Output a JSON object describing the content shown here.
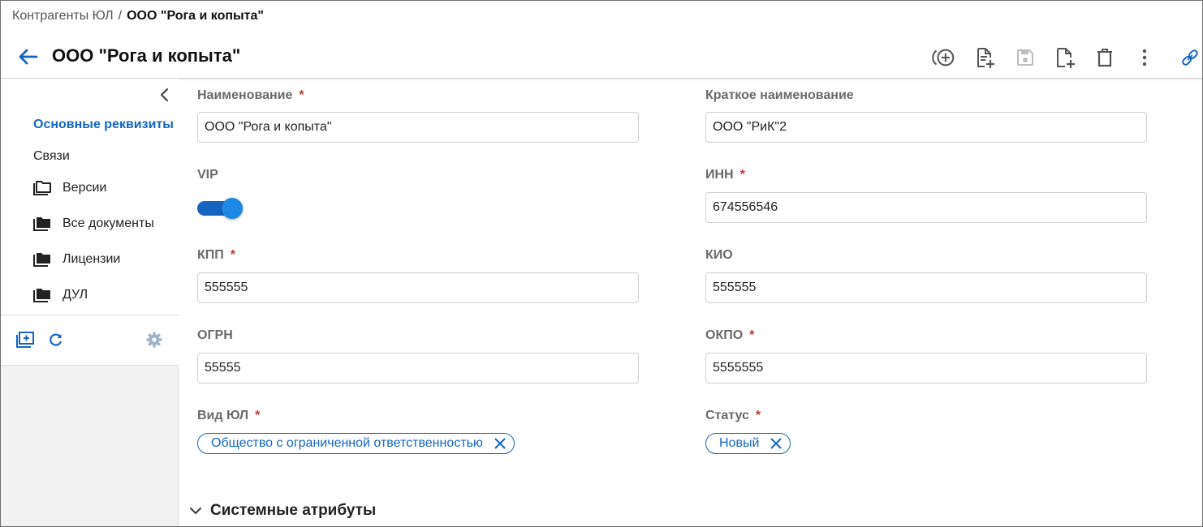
{
  "breadcrumb": {
    "parent": "Контрагенты ЮЛ",
    "separator": "/",
    "current": "ООО \"Рога и копыта\""
  },
  "header": {
    "title": "ООО \"Рога и копыта\"",
    "toolbar_icons": [
      "add-circle-icon",
      "add-document-icon",
      "save-icon",
      "new-file-icon",
      "delete-icon",
      "more-vert-icon",
      "link-icon"
    ],
    "save_disabled": true
  },
  "sidebar": {
    "items": [
      {
        "label": "Основные реквизиты",
        "active": true
      },
      {
        "label": "Связи",
        "active": false
      }
    ],
    "folders": [
      {
        "label": "Версии",
        "icon": "folder-outline-icon"
      },
      {
        "label": "Все документы",
        "icon": "folder-icon"
      },
      {
        "label": "Лицензии",
        "icon": "folder-icon"
      },
      {
        "label": "ДУЛ",
        "icon": "folder-icon"
      }
    ],
    "tools": [
      "create-folder-icon",
      "refresh-icon",
      "settings-icon"
    ]
  },
  "form": {
    "name": {
      "label": "Наименование",
      "required_mark": "*",
      "value": "ООО \"Рога и копыта\""
    },
    "short_name": {
      "label": "Краткое наименование",
      "value": "ООО \"РиК\"2"
    },
    "vip": {
      "label": "VIP",
      "on": true
    },
    "inn": {
      "label": "ИНН",
      "required_mark": "*",
      "value": "674556546"
    },
    "kpp": {
      "label": "КПП",
      "required_mark": "*",
      "value": "555555"
    },
    "kio": {
      "label": "КИО",
      "value": "555555"
    },
    "ogrn": {
      "label": "ОГРН",
      "value": "55555"
    },
    "okpo": {
      "label": "ОКПО",
      "required_mark": "*",
      "value": "5555555"
    },
    "entity_type": {
      "label": "Вид ЮЛ",
      "required_mark": "*",
      "chip": "Общество с ограниченной ответственностью"
    },
    "status": {
      "label": "Статус",
      "required_mark": "*",
      "chip": "Новый"
    }
  },
  "sections": {
    "system_attributes": "Системные атрибуты"
  },
  "colors": {
    "accent": "#1565c0",
    "required": "#c0392b",
    "sidebar_bg": "#f2f2f2"
  }
}
